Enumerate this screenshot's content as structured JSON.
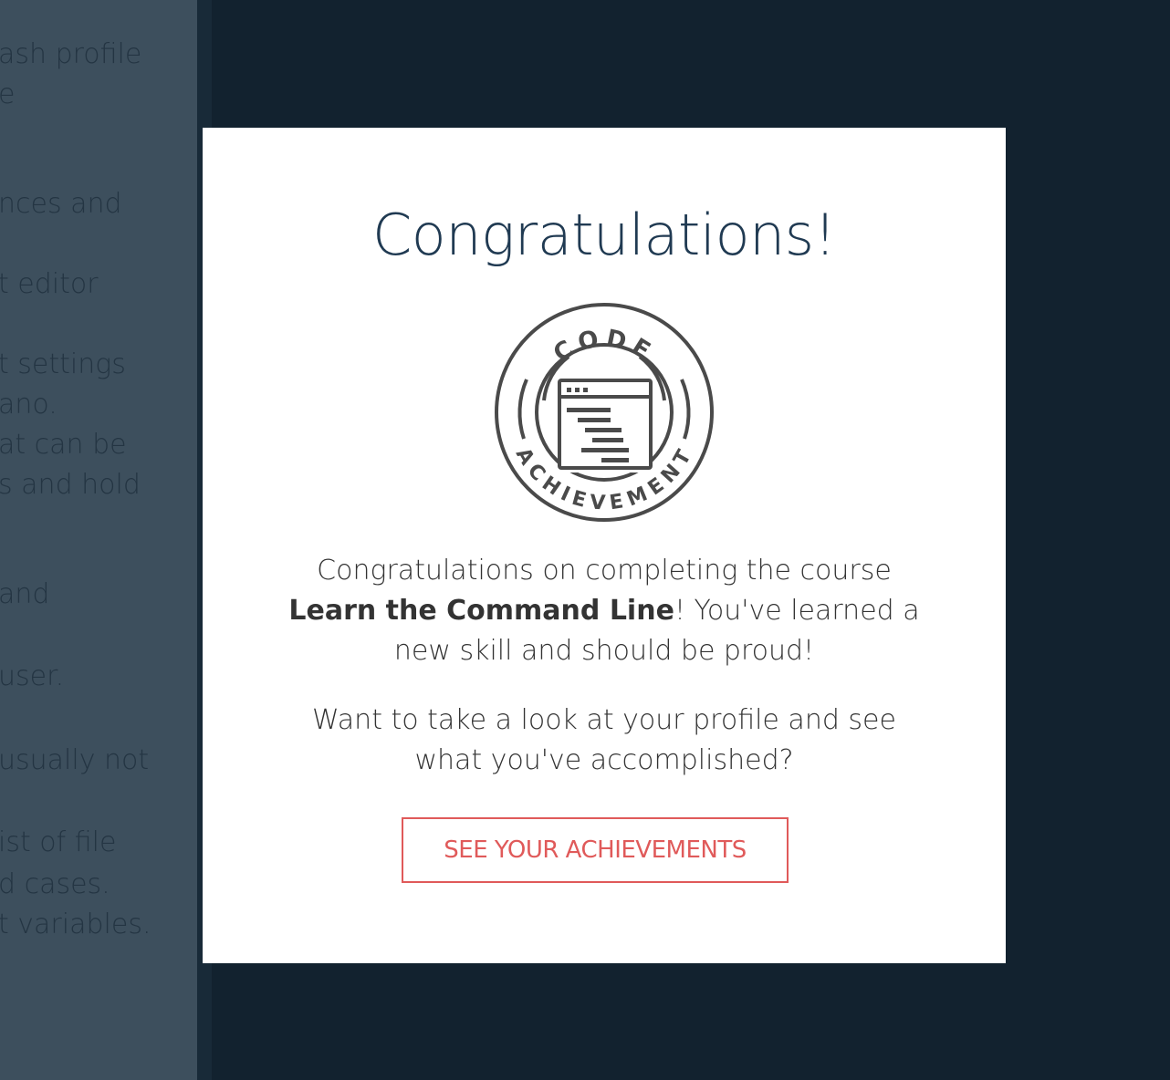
{
  "lesson_panel": {
    "lines": [
      "ash profile",
      "e",
      "nces and",
      "t editor",
      "t settings",
      "ano.",
      "at can be",
      "s and hold",
      "and",
      "user.",
      "usually not",
      "ist of file",
      "d cases.",
      "t variables."
    ]
  },
  "modal": {
    "title": "Congratulations!",
    "badge": {
      "icon": "code-achievement-badge-icon",
      "top_text": "CODE",
      "bottom_text": "ACHIEVEMENT",
      "color": "#4a4a4a"
    },
    "message": {
      "prefix": "Congratulations on completing the course ",
      "course_name": "Learn the Command Line",
      "suffix": "! You've learned a new skill and should be proud!"
    },
    "question": "Want to take a look at your profile and see what you've accomplished?",
    "cta_label": "SEE YOUR ACHIEVEMENTS"
  },
  "colors": {
    "backdrop": "#12222f",
    "panel": "#3d4f5d",
    "title": "#203a52",
    "accent": "#e05a5a"
  }
}
